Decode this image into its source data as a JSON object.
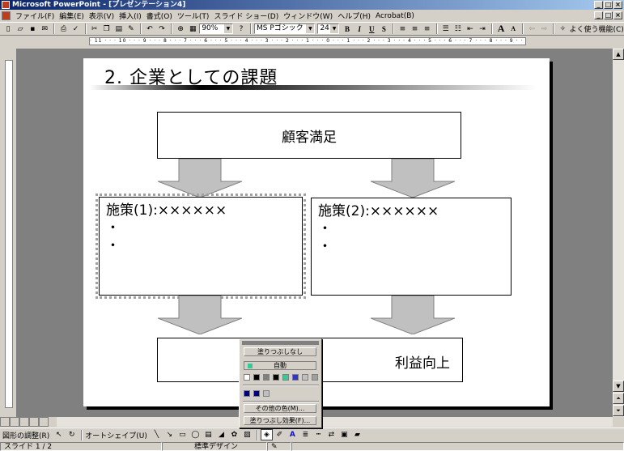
{
  "window": {
    "title": "Microsoft PowerPoint - [プレゼンテーション4]",
    "controls": [
      "_",
      "□",
      "×"
    ]
  },
  "menubar": {
    "items": [
      "ファイル(F)",
      "編集(E)",
      "表示(V)",
      "挿入(I)",
      "書式(O)",
      "ツール(T)",
      "スライド ショー(D)",
      "ウィンドウ(W)",
      "ヘルプ(H)",
      "Acrobat(B)"
    ]
  },
  "standard_toolbar": {
    "zoom": "90%",
    "font_name": "MS Pゴシック",
    "font_size": "24",
    "bold_label": "B",
    "italic_label": "I",
    "underline_label": "U",
    "shadow_label": "S",
    "grow_font_label": "A",
    "shrink_font_label": "A",
    "frequent_functions_label": "よく使う機能(C)"
  },
  "ruler": {
    "marks": "· 11 · · · 10 · · · 9 · · · 8 · · · 7 · · · 6 · · · 5 · · · 4 · · · 3 · · · 2 · · · 1 · · · 0 · · · 1 · · · 2 · · · 3 · · · 4 · · · 5 · · · 6 · · · 7 · · · 8 · · · 9 · · · 10 · · · 11 ·"
  },
  "slide": {
    "title": "2. 企業としての課題",
    "top_box": "顧客満足",
    "left_box": {
      "line1": "施策(1):××××××",
      "line2": "・",
      "line3": "・"
    },
    "right_box": {
      "line1": "施策(2):××××××",
      "line2": "・",
      "line3": "・"
    },
    "bottom_box_visible": "利益向上"
  },
  "fill_popup": {
    "no_fill": "塗りつぶしなし",
    "automatic": "自動",
    "more_colors": "その他の色(M)...",
    "fill_effects": "塗りつぶし効果(F)...",
    "swatches_row1": [
      "#ffffff",
      "#000000",
      "#808080",
      "#000000",
      "#33cc99",
      "#3333cc",
      "#c0c0c0",
      "#a0a0a0"
    ],
    "swatches_row2": [
      "#000080",
      "#000080",
      "#c0c0c0"
    ]
  },
  "drawing_toolbar": {
    "draw_menu": "図形の調整(R)",
    "autoshapes_menu": "オートシェイプ(U)"
  },
  "statusbar": {
    "slide_indicator": "スライド 1 / 2",
    "design_name": "標準デザイン"
  },
  "colors": {
    "titlebar_start": "#0a246a",
    "titlebar_end": "#a6caf0",
    "chrome": "#d4d0c8",
    "workspace": "#808080",
    "arrow_fill": "#c0c0c0"
  }
}
